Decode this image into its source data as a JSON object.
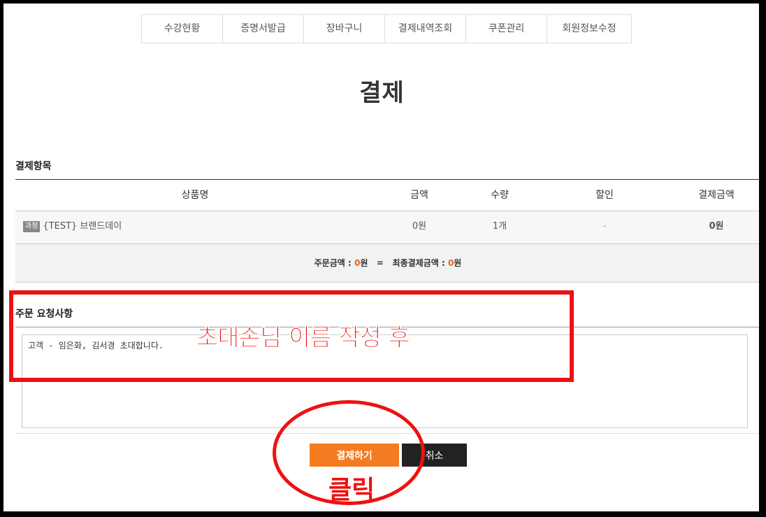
{
  "nav": {
    "tabs": [
      "수강현황",
      "증명서발급",
      "장바구니",
      "결제내역조회",
      "쿠폰관리",
      "회원정보수정"
    ]
  },
  "page_title": "결제",
  "payment_items": {
    "section_title": "결제항목",
    "headers": {
      "product": "상품명",
      "price": "금액",
      "quantity": "수량",
      "discount": "할인",
      "total": "결제금액"
    },
    "row": {
      "badge": "과정",
      "product": "{TEST} 브랜드데이",
      "price": "0원",
      "quantity": "1개",
      "discount": "-",
      "total": "0원"
    },
    "summary": {
      "order_label": "주문금액 : ",
      "order_amount": "0",
      "order_unit": "원",
      "equals": "=",
      "final_label": "최종결제금액 : ",
      "final_amount": "0",
      "final_unit": "원"
    }
  },
  "request": {
    "title": "주문 요청사항",
    "value": "고객 - 임은화, 김서경 초대합니다."
  },
  "buttons": {
    "pay": "결제하기",
    "cancel": "취소"
  },
  "annotations": {
    "instruction": "초대손님 이름 작성 후",
    "click": "클릭",
    "color": "#ee1111"
  },
  "colors": {
    "accent": "#f47b20",
    "dark_button": "#222222"
  }
}
